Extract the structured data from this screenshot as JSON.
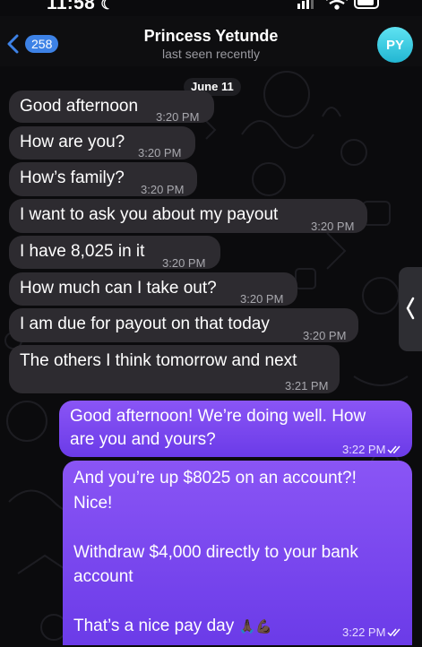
{
  "status": {
    "time": "11:58",
    "moon_icon": "crescent-moon-icon"
  },
  "header": {
    "back_count": "258",
    "title": "Princess Yetunde",
    "subtitle": "last seen recently",
    "avatar_initials": "PY"
  },
  "date_separator": "June 11",
  "incoming": [
    {
      "text": "Good afternoon",
      "time": "3:20 PM"
    },
    {
      "text": "How are you?",
      "time": "3:20 PM"
    },
    {
      "text": "How’s family?",
      "time": "3:20 PM"
    },
    {
      "text": "I want to ask you about my payout",
      "time": "3:20 PM"
    },
    {
      "text": "I have 8,025 in it",
      "time": "3:20 PM"
    },
    {
      "text": "How much can I take out?",
      "time": "3:20 PM"
    },
    {
      "text": "I am due for payout on that today",
      "time": "3:20 PM"
    },
    {
      "text": "The others I think tomorrow and next",
      "time": "3:21 PM"
    }
  ],
  "outgoing": [
    {
      "text": "Good afternoon! We’re doing well. How\nare you and yours?",
      "time": "3:22 PM",
      "read_status": "double-check-icon"
    },
    {
      "text": "And you’re up $8025 on an account?!\nNice!\n\nWithdraw $4,000 directly to your bank\naccount\n\nThat’s a nice pay day",
      "emoji": "🙏🏿💪🏿",
      "time": "3:22 PM",
      "read_status": "double-check-icon"
    }
  ],
  "colors": {
    "incoming_bubble": "#2d2b30",
    "outgoing_bubble": "#7b48f0",
    "badge": "#3d82e6",
    "avatar": "#3fcbe2"
  }
}
